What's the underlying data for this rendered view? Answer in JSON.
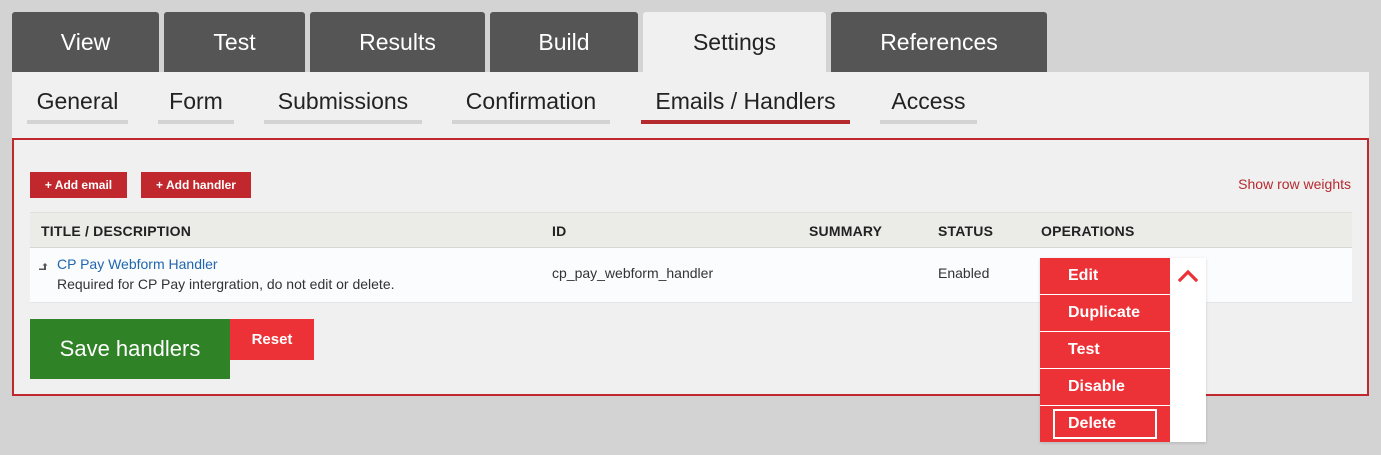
{
  "primary_tabs": [
    {
      "label": "View"
    },
    {
      "label": "Test"
    },
    {
      "label": "Results"
    },
    {
      "label": "Build"
    },
    {
      "label": "Settings",
      "active": true
    },
    {
      "label": "References"
    }
  ],
  "secondary_tabs": [
    {
      "label": "General"
    },
    {
      "label": "Form"
    },
    {
      "label": "Submissions"
    },
    {
      "label": "Confirmation"
    },
    {
      "label": "Emails / Handlers",
      "active": true
    },
    {
      "label": "Access"
    }
  ],
  "actions": {
    "add_email": "+ Add email",
    "add_handler": "+ Add handler",
    "show_row_weights": "Show row weights"
  },
  "table": {
    "headers": [
      "TITLE / DESCRIPTION",
      "ID",
      "SUMMARY",
      "STATUS",
      "OPERATIONS"
    ],
    "rows": [
      {
        "title": "CP Pay Webform Handler",
        "description": "Required for CP Pay intergration, do not edit or delete.",
        "id": "cp_pay_webform_handler",
        "summary": "",
        "status": "Enabled"
      }
    ]
  },
  "form_actions": {
    "save": "Save handlers",
    "reset": "Reset"
  },
  "operations_menu": {
    "items": [
      "Edit",
      "Duplicate",
      "Test",
      "Disable",
      "Delete"
    ],
    "focused": "Delete",
    "toggle_icon": "chevron-up-icon"
  },
  "colors": {
    "accent_red": "#c0282d",
    "op_red": "#ec3237",
    "save_green": "#2f8226",
    "link_blue": "#2166ae",
    "tab_dark": "#555555"
  }
}
